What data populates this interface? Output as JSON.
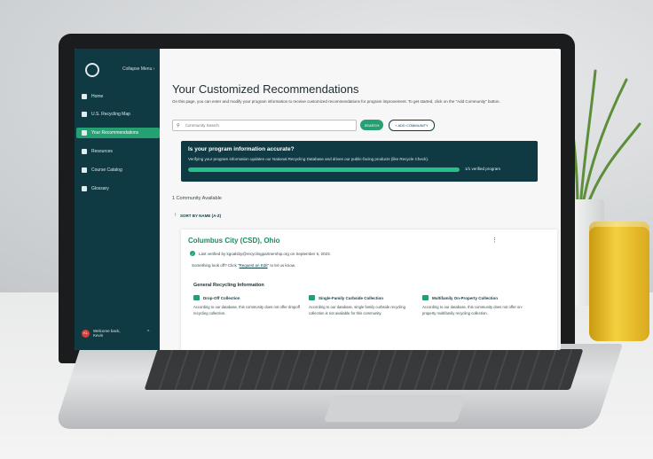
{
  "sidebar": {
    "collapse_label": "Collapse Menu",
    "items": [
      {
        "label": "Home",
        "icon": "home-icon"
      },
      {
        "label": "U.S. Recycling Map",
        "icon": "map-icon"
      },
      {
        "label": "Your Recommendations",
        "icon": "trophy-icon",
        "active": true
      },
      {
        "label": "Resources",
        "icon": "resources-icon"
      },
      {
        "label": "Course Catalog",
        "icon": "catalog-icon"
      },
      {
        "label": "Glossary",
        "icon": "glossary-icon"
      }
    ],
    "user": {
      "initials": "KL",
      "greeting": "Welcome back,",
      "name": "Kevin"
    }
  },
  "main": {
    "title": "Your Customized Recommendations",
    "intro": "On this page, you can enter and modify your program information to receive customized recommendations for program improvement. To get started, click on the \"Add Community\" button.",
    "search": {
      "placeholder": "Community Search"
    },
    "search_button": "SEARCH",
    "add_button": "+ ADD COMMUNITY",
    "banner": {
      "title": "Is your program information accurate?",
      "text": "Verifying your program information updates our National Recycling Database and drives our public-facing products (like Recycle Check).",
      "progress_label": "1/1 verified program",
      "progress_fraction": 1.0
    },
    "count_label": "1 Community Available",
    "sort_label": "SORT BY NAME (A-Z)",
    "card": {
      "title": "Columbus City (CSD), Ohio",
      "verified": "Last verified by kgoalsby@recyclingpartnership.org on September 6, 2023.",
      "lookoff_prefix": "Something look off? Click \"",
      "lookoff_link": "Request an Edit",
      "lookoff_suffix": "\" to let us know.",
      "section_title": "General Recycling Information",
      "columns": [
        {
          "heading": "Drop-Off Collection",
          "text": "According to our database, this community does not offer dropoff recycling collection."
        },
        {
          "heading": "Single-Family Curbside Collection",
          "text": "According to our database, single family curbside recycling collection is not available for this community."
        },
        {
          "heading": "Multifamily On-Property Collection",
          "text": "According to our database, this community does not offer on-property multifamily recycling collection."
        }
      ]
    }
  },
  "colors": {
    "sidebar_bg": "#0f3a44",
    "accent": "#25a073",
    "title_green": "#1f8a5e"
  }
}
